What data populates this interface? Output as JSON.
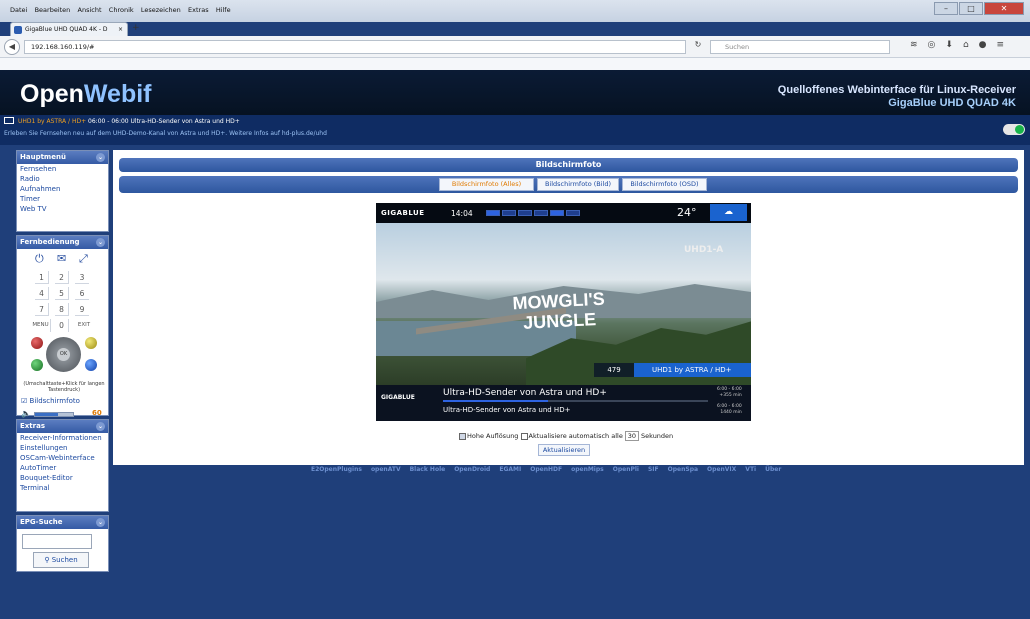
{
  "browser": {
    "menu": [
      "Datei",
      "Bearbeiten",
      "Ansicht",
      "Chronik",
      "Lesezeichen",
      "Extras",
      "Hilfe"
    ],
    "tab_title": "GigaBlue UHD QUAD 4K - D",
    "tab_close": "×",
    "new_tab": "+",
    "url": "192.168.160.119/#",
    "search_placeholder": "Suchen",
    "win_minimize": "–",
    "win_maximize": "□",
    "win_close": "✕"
  },
  "header": {
    "logo_open": "Open",
    "logo_webif": "Webif",
    "tagline": "Quelloffenes Webinterface für Linux-Receiver",
    "receiver": "GigaBlue UHD QUAD 4K"
  },
  "nowplaying": {
    "channel": "UHD1 by ASTRA / HD+",
    "program": "06:00 - 06:00 Ultra-HD-Sender von Astra und HD+",
    "description": "Erleben Sie Fernsehen neu auf dem UHD-Demo-Kanal von Astra und HD+. Weitere Infos auf hd-plus.de/uhd"
  },
  "sidebar": {
    "main_title": "Hauptmenü",
    "main_items": [
      "Fernsehen",
      "Radio",
      "Aufnahmen",
      "Timer",
      "Web TV"
    ],
    "remote_title": "Fernbedienung",
    "keys": [
      "1",
      "2",
      "3",
      "4",
      "5",
      "6",
      "7",
      "8",
      "9",
      "MENU",
      "0",
      "EXIT"
    ],
    "ok_label": "OK",
    "shift_hint": "(Umschalttaste+Klick für langen Tastendruck)",
    "screenshot_label": "Bildschirmfoto",
    "volume": 60,
    "volume_label": "60",
    "extras_title": "Extras",
    "extras_items": [
      "Receiver-Informationen",
      "Einstellungen",
      "OSCam-Webinterface",
      "AutoTimer",
      "Bouquet-Editor",
      "Terminal"
    ],
    "epg_title": "EPG-Suche",
    "epg_button": "Suchen"
  },
  "main": {
    "title": "Bildschirmfoto",
    "tabs": [
      "Bildschirmfoto (Alles)",
      "Bildschirmfoto (Bild)",
      "Bildschirmfoto (OSD)"
    ],
    "hires_label": "Hohe Auflösung",
    "auto_label": "Aktualisiere automatisch alle",
    "interval": "30",
    "seconds": "Sekunden",
    "refresh": "Aktualisieren"
  },
  "screenshot": {
    "brand": "GIGABLUE",
    "time": "14:04",
    "temp": "24°",
    "channel_logo": "UHD1-A",
    "title_text_1": "MOWGLI'S",
    "title_text_2": "JUNGLE",
    "channel_number": "479",
    "channel_name": "UHD1 by ASTRA / HD+",
    "footer_brand": "GIGABLUE",
    "program_now": "Ultra-HD-Sender von Astra und HD+",
    "program_next": "Ultra-HD-Sender von Astra und HD+",
    "time_now": "6:00 - 6:00",
    "remain_now": "+355 min",
    "time_next": "6:00 - 6:00",
    "dur_next": "1440 min"
  },
  "footer_links": [
    "E2OpenPlugins",
    "openATV",
    "Black Hole",
    "OpenDroid",
    "EGAMI",
    "OpenHDF",
    "openMips",
    "OpenPli",
    "SIF",
    "OpenSpa",
    "OpenVIX",
    "VTi",
    "Über"
  ],
  "colors": {
    "accent": "#e07a00",
    "header_blue": "#0f2c63",
    "link": "#1d4aa0"
  }
}
